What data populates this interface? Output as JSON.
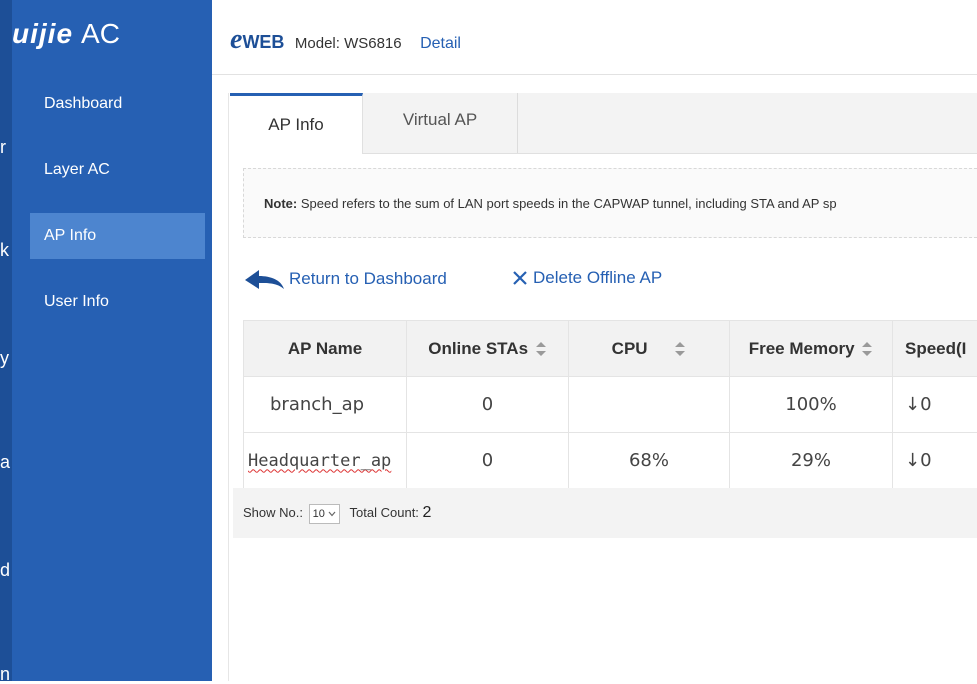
{
  "sidebar": {
    "brand_logo": "uijie",
    "brand_suffix": "AC",
    "strip_fragments": [
      "r",
      "k",
      "y",
      "a",
      "d",
      "n"
    ],
    "items": [
      {
        "label": "Dashboard"
      },
      {
        "label": "Layer AC"
      },
      {
        "label": "AP Info"
      },
      {
        "label": "User Info"
      }
    ]
  },
  "header": {
    "eweb_e": "e",
    "eweb_text": "WEB",
    "model": "Model: WS6816",
    "detail": "Detail"
  },
  "tabs": [
    {
      "label": "AP Info"
    },
    {
      "label": "Virtual AP"
    }
  ],
  "note": {
    "label": "Note:",
    "text": "Speed refers to the sum of LAN port speeds in the CAPWAP tunnel, including STA and AP sp"
  },
  "actions": {
    "return": "Return to Dashboard",
    "delete": "Delete Offline AP"
  },
  "table": {
    "headers": [
      "AP Name",
      "Online STAs",
      "CPU",
      "Free Memory",
      "Speed(I"
    ],
    "rows": [
      {
        "name": "branch_ap",
        "online_stas": "0",
        "cpu": "",
        "free_memory": "100%",
        "speed": "↓0"
      },
      {
        "name": "Headquarter_ap",
        "online_stas": "0",
        "cpu": "68%",
        "free_memory": "29%",
        "speed": "↓0"
      }
    ]
  },
  "footer": {
    "show_label": "Show No.:",
    "show_value": "10",
    "total_label": "Total Count:",
    "total_value": "2"
  },
  "colors": {
    "sidebar": "#2660b3",
    "sidebar_active": "#4d85cf",
    "accent": "#2660b3",
    "speed_green": "#2e9a2e"
  }
}
